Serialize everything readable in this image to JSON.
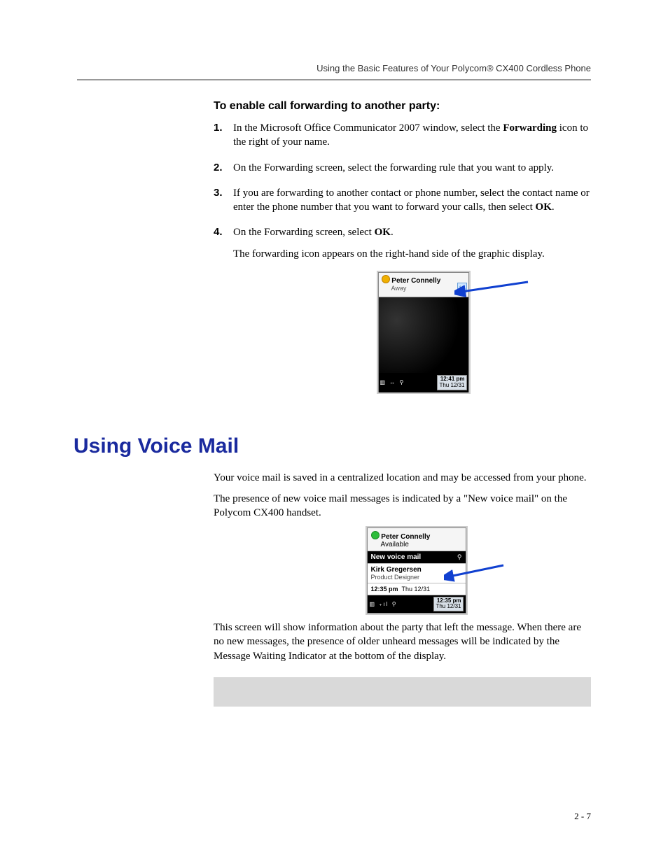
{
  "header": "Using the Basic Features of Your Polycom® CX400 Cordless Phone",
  "proc_title": "To enable call forwarding to another party:",
  "steps": {
    "n1": "1.",
    "s1a": "In the Microsoft Office Communicator 2007 window, select the ",
    "s1b": "Forwarding",
    "s1c": " icon to the right of your name.",
    "n2": "2.",
    "s2": "On the Forwarding screen, select the forwarding rule that you want to apply.",
    "n3": "3.",
    "s3a": "If you are forwarding to another contact or phone number, select the contact name or enter the phone number that you want to forward your calls, then select ",
    "s3b": "OK",
    "s3c": ".",
    "n4": "4.",
    "s4a": "On the Forwarding screen, select ",
    "s4b": "OK",
    "s4c": ".",
    "s4d": "The forwarding icon appears on the right-hand side of the graphic display."
  },
  "phone1": {
    "name": "Peter Connelly",
    "status": "Away",
    "time": "12:41 pm",
    "date": "Thu 12/31"
  },
  "section_title": "Using Voice Mail",
  "vm_p1": "Your voice mail is saved in a centralized location and may be accessed from your phone.",
  "vm_p2": "The presence of new voice mail messages is indicated by a \"New voice mail\" on the Polycom CX400 handset.",
  "phone2": {
    "name": "Peter Connelly",
    "status": "Available",
    "nvm": "New voice mail",
    "contact_name": "Kirk Gregersen",
    "contact_title": "Product Designer",
    "dt_time": "12:35 pm",
    "dt_date": "Thu 12/31",
    "foot_time": "12:35 pm",
    "foot_date": "Thu 12/31"
  },
  "vm_p3": "This screen will show information about the party that left the message. When there are no new messages, the presence of older unheard messages will be indicated by the Message Waiting Indicator at the bottom of the display.",
  "page_num": "2 - 7"
}
